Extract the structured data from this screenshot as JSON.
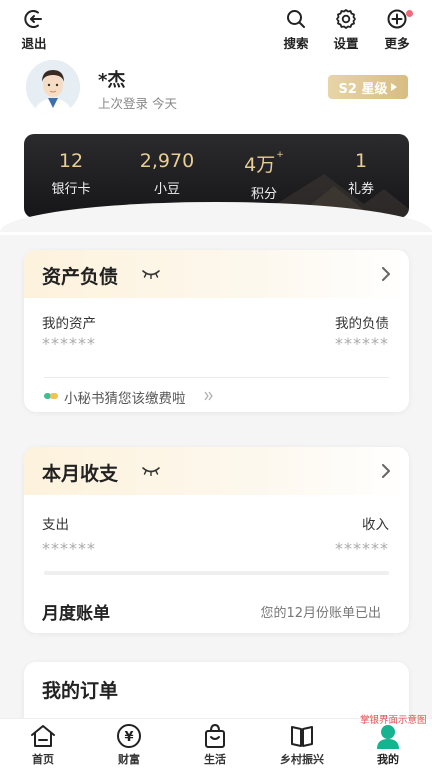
{
  "toolbar": {
    "exit_label": "退出",
    "search_label": "搜索",
    "settings_label": "设置",
    "more_label": "更多"
  },
  "profile": {
    "name": "*杰",
    "last_login": "上次登录 今天",
    "level": "S2 星级"
  },
  "stats": [
    {
      "value": "12",
      "label": "银行卡"
    },
    {
      "value": "2,970",
      "label": "小豆"
    },
    {
      "value": "4万",
      "sup": "+",
      "label": "积分"
    },
    {
      "value": "1",
      "label": "礼券"
    }
  ],
  "assets": {
    "title": "资产负债",
    "my_assets_label": "我的资产",
    "my_liabilities_label": "我的负债",
    "assets_masked": "******",
    "liabilities_masked": "******",
    "tip": "小秘书猜您该缴费啦"
  },
  "monthly": {
    "title": "本月收支",
    "expense_label": "支出",
    "income_label": "收入",
    "expense_masked": "******",
    "income_masked": "******",
    "bill_title": "月度账单",
    "bill_note": "您的12月份账单已出"
  },
  "orders": {
    "title": "我的订单"
  },
  "nav": {
    "items": [
      {
        "label": "首页"
      },
      {
        "label": "财富"
      },
      {
        "label": "生活"
      },
      {
        "label": "乡村振兴"
      },
      {
        "label": "我的"
      }
    ],
    "active_index": 4
  },
  "watermark": "掌银界面示意图",
  "colors": {
    "accent_green": "#17b28f",
    "gold": "#e8cd94",
    "badge_gold": "#d8bd83",
    "notify_red": "#f06a7a"
  }
}
